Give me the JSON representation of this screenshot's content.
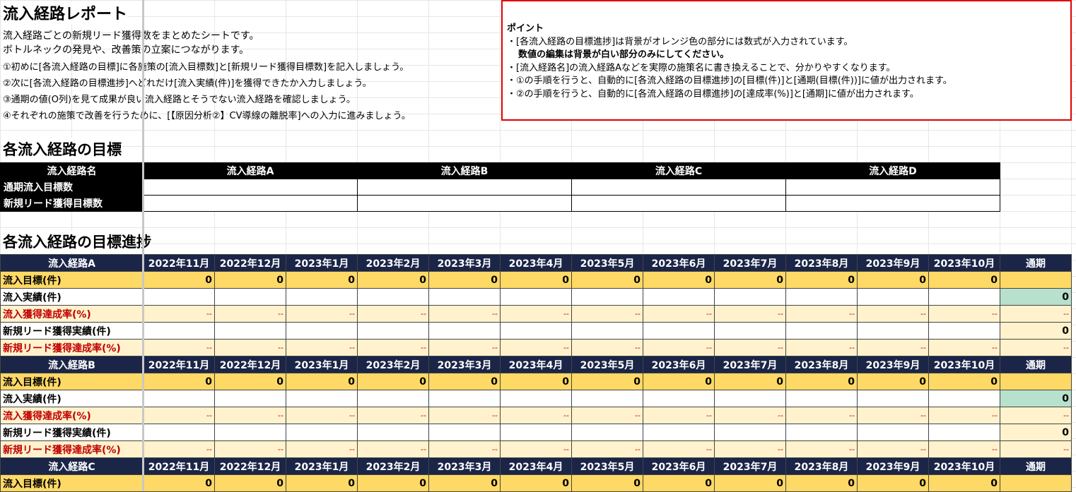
{
  "title": "流入経路レポート",
  "description": [
    "流入経路ごとの新規リード獲得数をまとめたシートです。",
    "ボトルネックの発見や、改善策の立案につながります。"
  ],
  "steps": [
    "①初めに[各流入経路の目標]に各施策の[流入目標数]と[新規リード獲得目標数]を記入しましょう。",
    "②次に[各流入経路の目標進捗]へどれだけ[流入実績(件)]を獲得できたか入力しましょう。",
    "③通期の値(O列)を見て成果が良い流入経路とそうでない流入経路を確認しましょう。",
    "④それぞれの施策で改善を行うために、[【原因分析②】CV導線の離脱率]への入力に進みましょう。"
  ],
  "point": {
    "title": "ポイント",
    "lines": [
      "・[各流入経路の目標進捗]は背景がオレンジ色の部分には数式が入力されています。",
      "数値の編集は背景が白い部分のみにしてください。",
      "・[流入経路名]の流入経路Aなどを実際の施策名に書き換えることで、分かりやすくなります。",
      "・①の手順を行うと、自動的に[各流入経路の目標進捗]の[目標(件)]と[通期(目標(件))]に値が出力されます。",
      "・②の手順を行うと、自動的に[各流入経路の目標進捗]の[達成率(%)]と[通期]に値が出力されます。"
    ]
  },
  "goal_section": {
    "title": "各流入経路の目標",
    "header_label": "流入経路名",
    "routes": [
      "流入経路A",
      "流入経路B",
      "流入経路C",
      "流入経路D"
    ],
    "rows": [
      "通期流入目標数",
      "新規リード獲得目標数"
    ]
  },
  "progress_section": {
    "title": "各流入経路の目標進捗",
    "months": [
      "2022年11月",
      "2022年12月",
      "2023年1月",
      "2023年2月",
      "2023年3月",
      "2023年4月",
      "2023年5月",
      "2023年6月",
      "2023年7月",
      "2023年8月",
      "2023年9月",
      "2023年10月"
    ],
    "total_label": "通期",
    "row_labels": {
      "target": "流入目標(件)",
      "actual": "流入実績(件)",
      "rate": "流入獲得達成率(%)",
      "lead": "新規リード獲得実績(件)",
      "lead_rate": "新規リード獲得達成率(%)"
    },
    "zero": "0",
    "dash": "--",
    "blocks": [
      {
        "route": "流入経路A"
      },
      {
        "route": "流入経路B"
      },
      {
        "route": "流入経路C"
      }
    ]
  },
  "colors": {
    "header_navy": "#1b2547",
    "target_orange": "#ffd966",
    "rate_light": "#fff2cc",
    "actual_total_green": "#b7e1cd",
    "rate_text_red": "#c00000",
    "point_border_red": "#e00000"
  }
}
